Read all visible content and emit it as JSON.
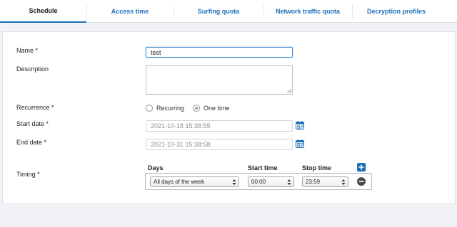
{
  "tabs": [
    {
      "label": "Schedule",
      "active": true
    },
    {
      "label": "Access time",
      "active": false
    },
    {
      "label": "Surfing quota",
      "active": false
    },
    {
      "label": "Network traffic quota",
      "active": false
    },
    {
      "label": "Decryption profiles",
      "active": false
    }
  ],
  "form": {
    "name_label": "Name *",
    "name_value": "test",
    "description_label": "Description",
    "description_value": "",
    "recurrence_label": "Recurrence *",
    "recurrence_options": [
      {
        "label": "Recurring",
        "selected": false
      },
      {
        "label": "One time",
        "selected": true
      }
    ],
    "start_date_label": "Start date *",
    "start_date_value": "2021-10-18 15:38:55",
    "end_date_label": "End date *",
    "end_date_value": "2021-10-31 15:38:58",
    "timing_label": "Timing *"
  },
  "timing": {
    "columns": [
      "Days",
      "Start time",
      "Stop time"
    ],
    "rows": [
      {
        "days": "All days of the week",
        "start": "00:00",
        "stop": "23:59"
      }
    ]
  },
  "icons": {
    "calendar": "calendar-icon",
    "add": "plus-icon",
    "remove": "minus-icon",
    "accent": "#1d6fb8"
  }
}
